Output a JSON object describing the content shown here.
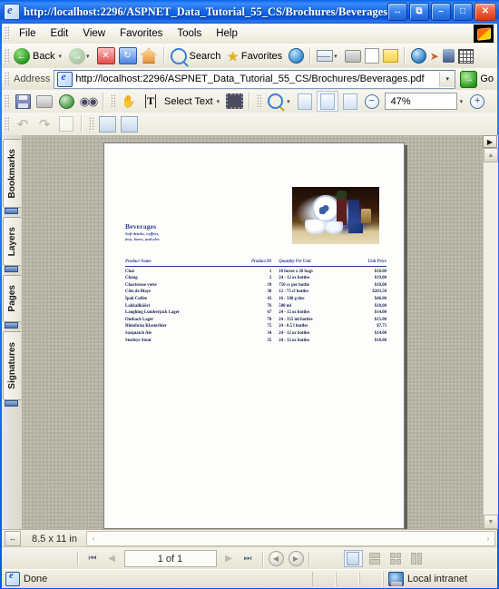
{
  "window": {
    "title": "http://localhost:2296/ASPNET_Data_Tutorial_55_CS/Brochures/Beverages.pdf",
    "buttons": {
      "restore_small": "↔",
      "restore_window": "⧉",
      "minimize": "–",
      "maximize": "□",
      "close": "✕"
    }
  },
  "menubar": {
    "items": [
      "File",
      "Edit",
      "View",
      "Favorites",
      "Tools",
      "Help"
    ]
  },
  "ie_toolbar": {
    "back_label": "Back",
    "search_label": "Search",
    "favorites_label": "Favorites",
    "dropdown_caret": "▾",
    "stop_glyph": "✕",
    "refresh_glyph": "↻",
    "forward_glyph": "→",
    "back_glyph": "←"
  },
  "address_bar": {
    "label": "Address",
    "url": "http://localhost:2296/ASPNET_Data_Tutorial_55_CS/Brochures/Beverages.pdf",
    "dropdown_caret": "▾",
    "go_label": "Go",
    "go_glyph": "→"
  },
  "pdf_toolbar": {
    "select_text_label": "Select Text",
    "zoom_value": "47%",
    "caret": "▾",
    "minus_glyph": "−",
    "plus_glyph": "+",
    "hand_glyph": "✋",
    "select_glyph": "T",
    "find_glyph": "ඞඞ"
  },
  "sidebar": {
    "tabs": [
      "Bookmarks",
      "Layers",
      "Pages",
      "Signatures"
    ]
  },
  "document": {
    "heading": "Beverages",
    "subtitle_line1": "Soft drinks, coffees,",
    "subtitle_line2": "teas, beers, and ales",
    "table": {
      "columns": [
        "Product Name",
        "Product ID",
        "Quantity Per Unit",
        "Unit Price"
      ],
      "rows": [
        [
          "Chai",
          "1",
          "10 boxes x 20 bags",
          "$18.00"
        ],
        [
          "Chang",
          "2",
          "24 - 12 oz bottles",
          "$19.00"
        ],
        [
          "Chartreuse verte",
          "39",
          "750 cc per bottle",
          "$18.00"
        ],
        [
          "Côte de Blaye",
          "38",
          "12 - 75 cl bottles",
          "$263.50"
        ],
        [
          "Ipoh Coffee",
          "43",
          "16 - 500 g tins",
          "$46.00"
        ],
        [
          "Lakkalikööri",
          "76",
          "500 ml",
          "$18.00"
        ],
        [
          "Laughing Lumberjack Lager",
          "67",
          "24 - 12 oz bottles",
          "$14.00"
        ],
        [
          "Outback Lager",
          "70",
          "24 - 355 ml bottles",
          "$15.00"
        ],
        [
          "Rhönbräu Klosterbier",
          "75",
          "24 - 0.5 l bottles",
          "$7.75"
        ],
        [
          "Sasquatch Ale",
          "34",
          "24 - 12 oz bottles",
          "$14.00"
        ],
        [
          "Steeleye Stout",
          "35",
          "24 - 12 oz bottles",
          "$18.00"
        ]
      ]
    }
  },
  "pdf_status": {
    "page_size": "8.5 x 11 in",
    "resize_glyph": "↔",
    "scroll_left_glyph": "‹",
    "scroll_right_glyph": "›"
  },
  "page_nav": {
    "first_glyph": "⏮",
    "prev_glyph": "◀",
    "page_indicator": "1 of 1",
    "next_glyph": "▶",
    "last_glyph": "⏭",
    "prev_view_glyph": "◀",
    "next_view_glyph": "▶"
  },
  "status_bar": {
    "status_text": "Done",
    "zone_text": "Local intranet"
  },
  "colors": {
    "title_blue": "#0a5ae0",
    "pdf_text_blue": "#2b3a8f",
    "close_red": "#d8381a",
    "page_bg": "#fdfdfb"
  }
}
